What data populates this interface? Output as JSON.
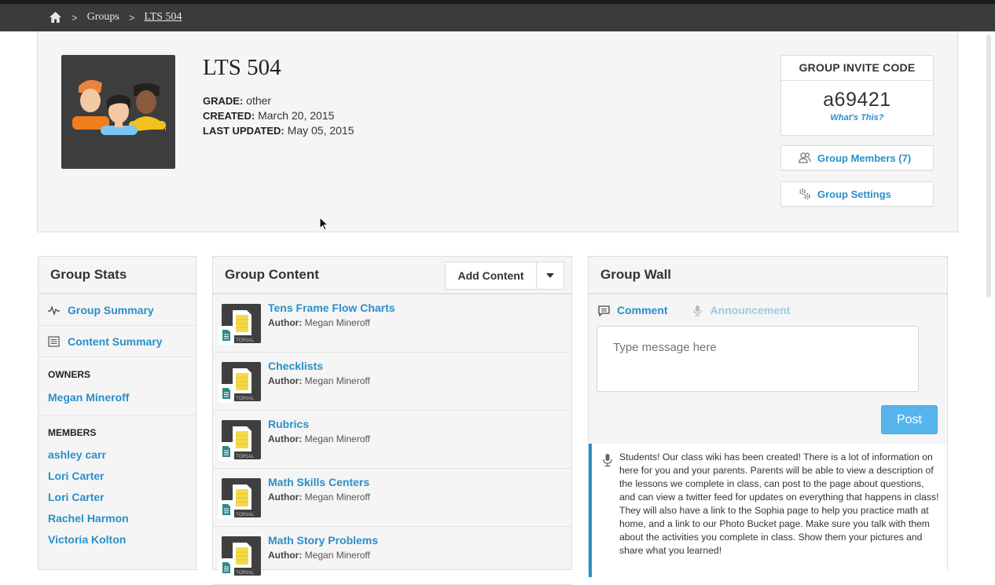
{
  "breadcrumb": {
    "home_icon": "home-icon",
    "separator": ">",
    "groups": "Groups",
    "current": "LTS 504"
  },
  "group": {
    "title": "LTS 504",
    "grade_label": "GRADE:",
    "grade_value": "other",
    "created_label": "CREATED:",
    "created_value": "March 20, 2015",
    "updated_label": "LAST UPDATED:",
    "updated_value": "May 05, 2015"
  },
  "invite": {
    "heading": "GROUP INVITE CODE",
    "code": "a69421",
    "help_link": "What's This?"
  },
  "actions": {
    "members": "Group Members (7)",
    "settings": "Group Settings"
  },
  "stats": {
    "title": "Group Stats",
    "summary_link": "Group Summary",
    "content_summary_link": "Content Summary",
    "owners_heading": "OWNERS",
    "owners": [
      "Megan Mineroff"
    ],
    "members_heading": "MEMBERS",
    "members": [
      {
        "first": "ashley",
        "last": "carr"
      },
      {
        "first": "Lori",
        "last": "Carter"
      },
      {
        "first": "Lori",
        "last": "Carter"
      },
      {
        "first": "Rachel",
        "last": "Harmon"
      },
      {
        "first": "Victoria",
        "last": "Kolton"
      }
    ]
  },
  "content": {
    "title": "Group Content",
    "add_button": "Add Content",
    "author_label": "Author:",
    "thumb_caption": "TORIAL",
    "items": [
      {
        "title": "Tens Frame Flow Charts",
        "author": "Megan Mineroff"
      },
      {
        "title": "Checklists",
        "author": "Megan Mineroff"
      },
      {
        "title": "Rubrics",
        "author": "Megan Mineroff"
      },
      {
        "title": "Math Skills Centers",
        "author": "Megan Mineroff"
      },
      {
        "title": "Math Story Problems",
        "author": "Megan Mineroff"
      }
    ]
  },
  "wall": {
    "title": "Group Wall",
    "tab_comment": "Comment",
    "tab_announcement": "Announcement",
    "placeholder": "Type message here",
    "post_button": "Post",
    "post_text": "Students! Our class wiki has been created! There is a lot of information on here for you and your parents. Parents will be able to view a description of the lessons we complete in class, can post to the page about questions, and can view a twitter feed for updates on everything that happens in class! They will also have a link to the Sophia page to help you practice math at home, and a link to our Photo Bucket page. Make sure you talk with them about the activities you complete in class. Show them your pictures and share what you learned!"
  },
  "colors": {
    "link": "#2a8fc9",
    "topbar": "#3b3b3b",
    "post_button": "#56b5ec"
  }
}
